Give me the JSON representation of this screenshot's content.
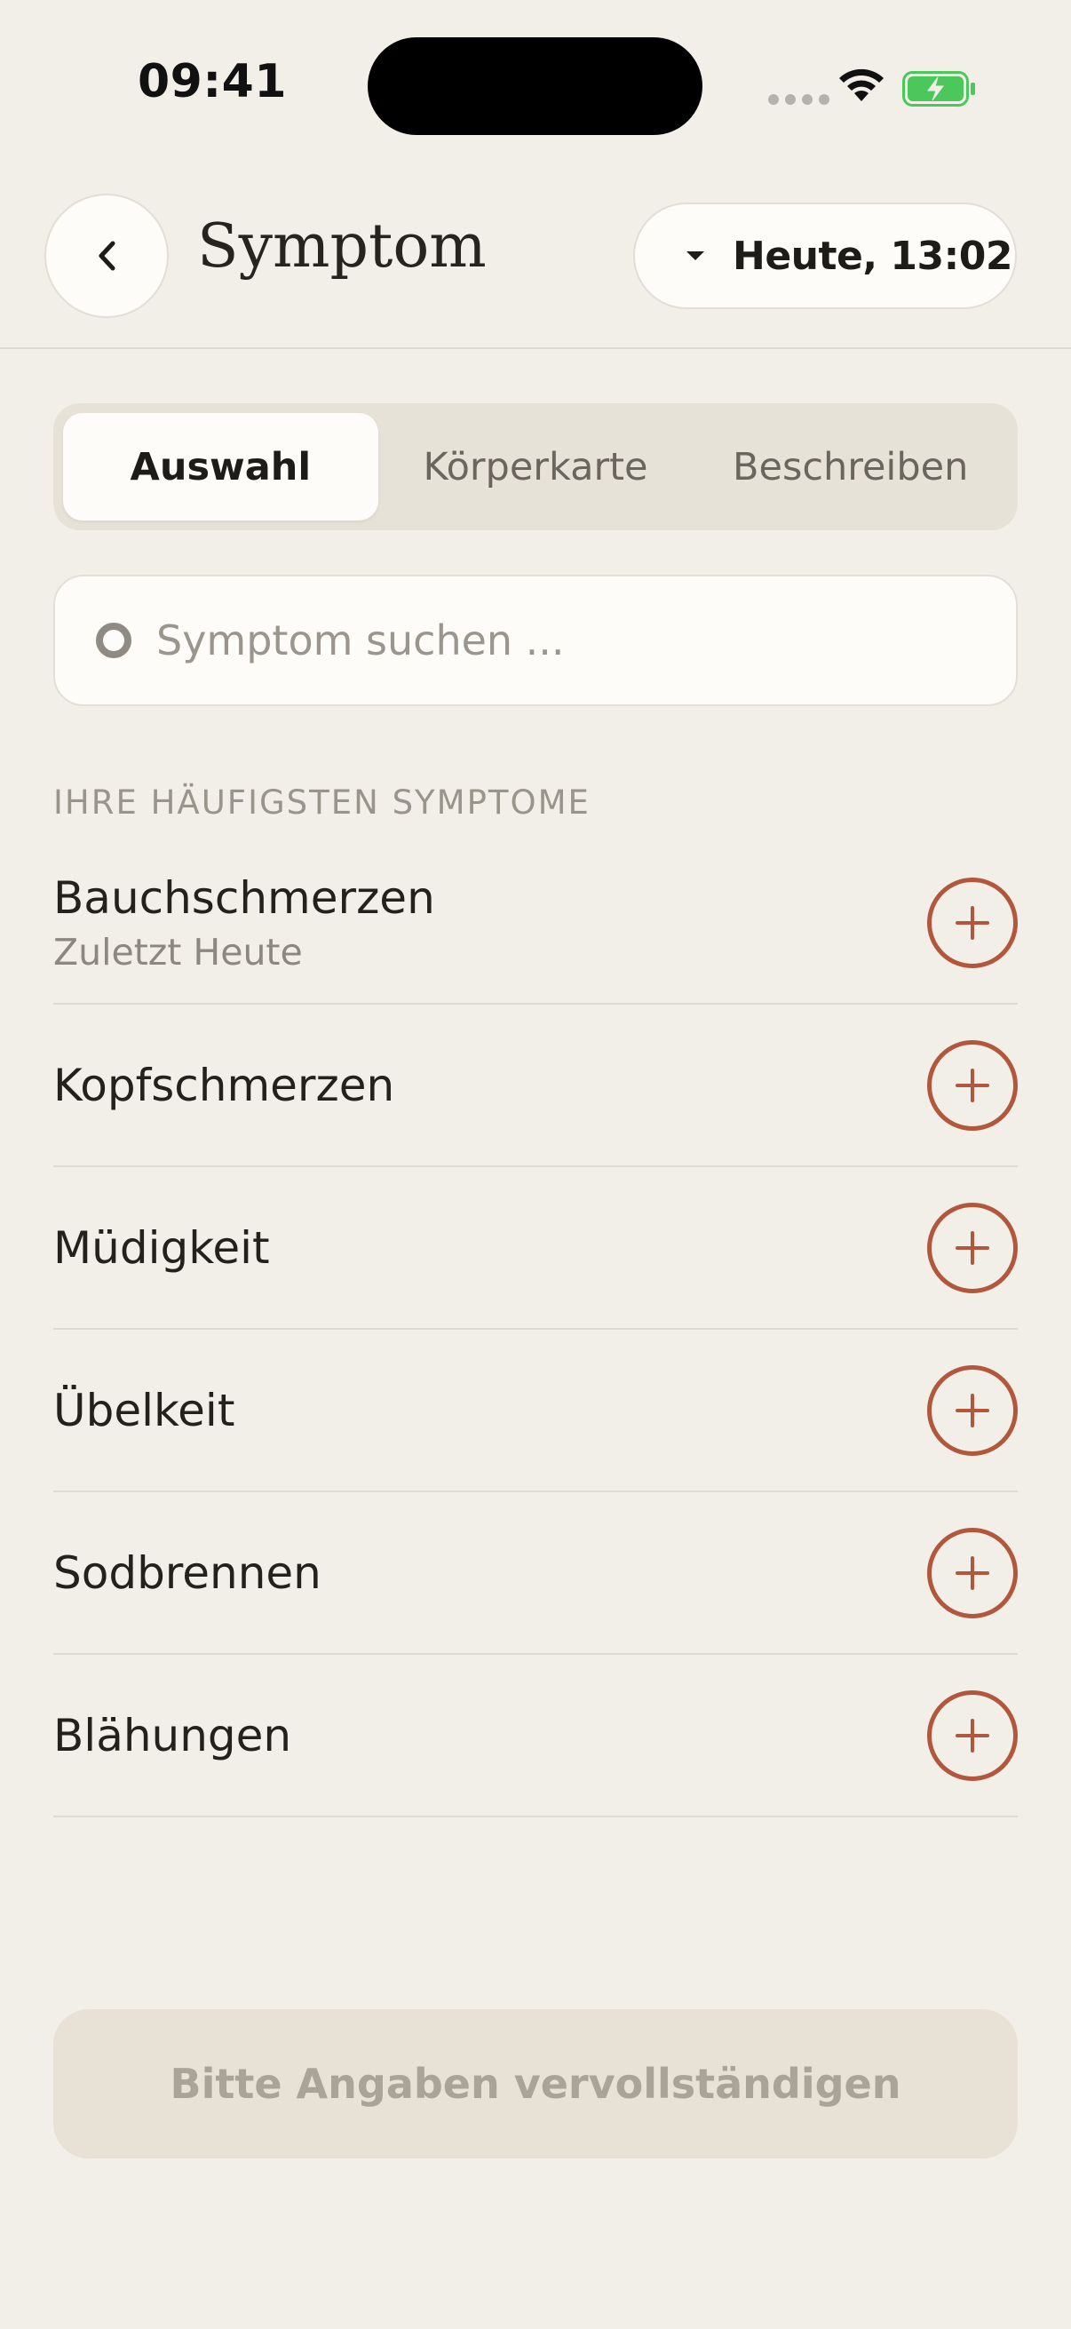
{
  "status_bar": {
    "time": "09:41"
  },
  "header": {
    "title": "Symptom",
    "back_icon": "chevron-left-icon",
    "date_label": "Heute, 13:02",
    "date_icon": "caret-down-icon"
  },
  "tabs": [
    {
      "label": "Auswahl",
      "active": true
    },
    {
      "label": "Körperkarte",
      "active": false
    },
    {
      "label": "Beschreiben",
      "active": false
    }
  ],
  "search": {
    "placeholder": "Symptom suchen ...",
    "value": ""
  },
  "frequent": {
    "title": "IHRE HÄUFIGSTEN SYMPTOME",
    "items": [
      {
        "name": "Bauchschmerzen",
        "sub": "Zuletzt Heute"
      },
      {
        "name": "Kopfschmerzen"
      },
      {
        "name": "Müdigkeit"
      },
      {
        "name": "Übelkeit"
      },
      {
        "name": "Sodbrennen"
      },
      {
        "name": "Blähungen"
      }
    ]
  },
  "cta": {
    "label": "Bitte Angaben vervollständigen"
  },
  "colors": {
    "background": "#f2efe8",
    "accent": "#b2573c",
    "battery": "#4cc75c"
  }
}
